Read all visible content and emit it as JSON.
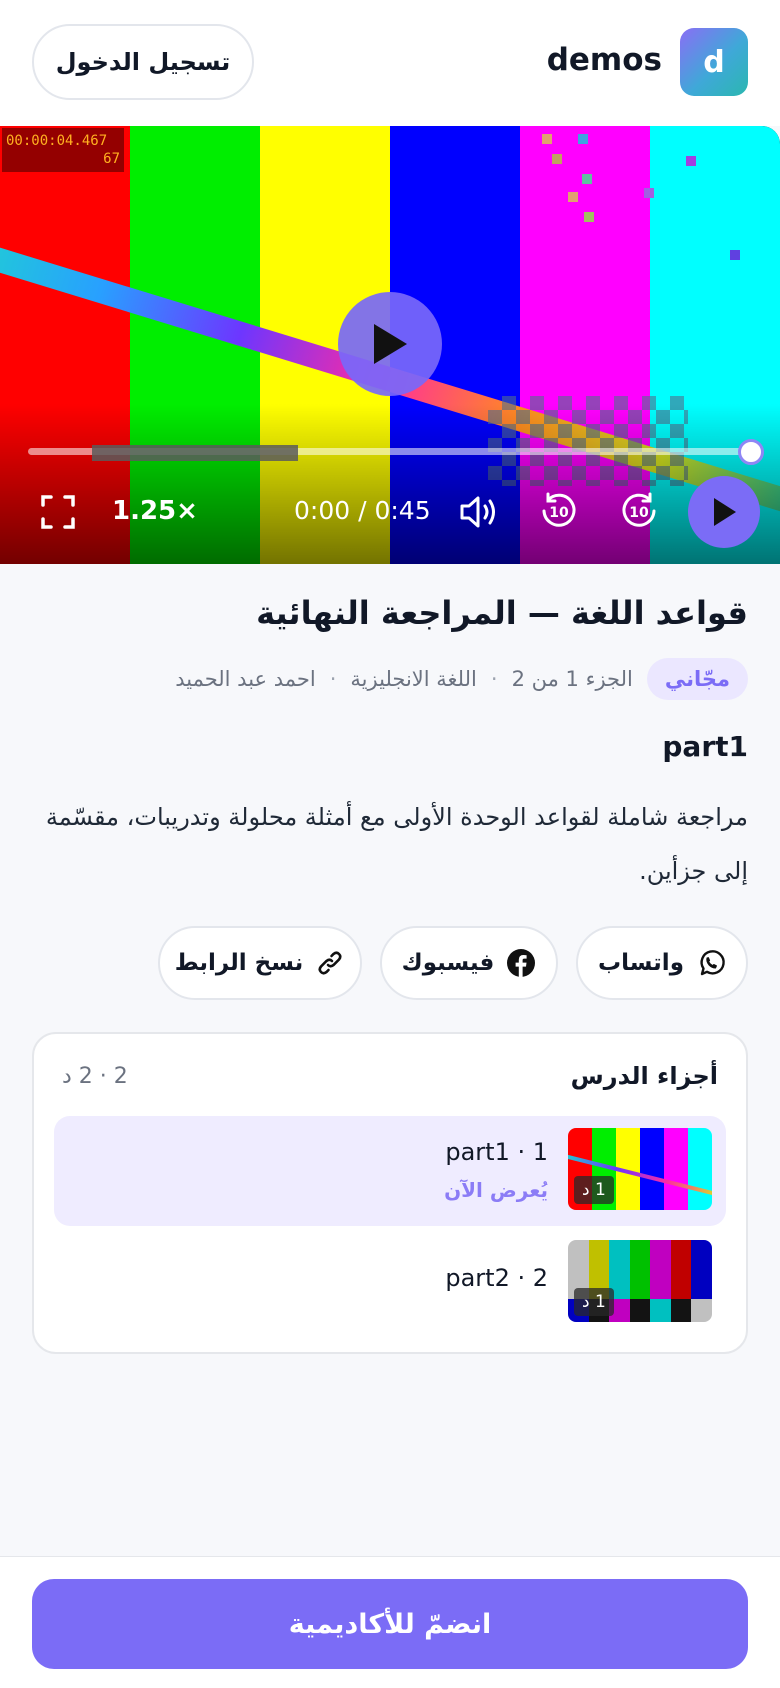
{
  "header": {
    "logo_letter": "d",
    "brand": "demos",
    "login_label": "تسجيل الدخول"
  },
  "video": {
    "timecode": "00:00:04.467",
    "frame": "67",
    "speed": "1.25×",
    "time_display": "0:00 / 0:45",
    "skip_back_seconds": "10",
    "skip_forward_seconds": "10",
    "played_fraction": 0.0,
    "bar_colors": [
      "#ff0000",
      "#00ee00",
      "#ffff00",
      "#0000ff",
      "#ff00ff",
      "#00ffff"
    ]
  },
  "lesson": {
    "title": "قواعد اللغة — المراجعة النهائية",
    "badge": "مجّاني",
    "part_info": "الجزء 1 من 2",
    "subject": "اللغة الانجليزية",
    "teacher": "احمد عبد الحميد",
    "part_heading": "part1",
    "description": "مراجعة شاملة لقواعد الوحدة الأولى مع أمثلة محلولة وتدريبات، مقسّمة إلى جزأين."
  },
  "share": {
    "whatsapp": "واتساب",
    "facebook": "فيسبوك",
    "copy_link": "نسخ الرابط"
  },
  "parts": {
    "title": "أجزاء الدرس",
    "count": "2 · 2 د",
    "items": [
      {
        "name": "part1 · 1",
        "status": "يُعرض الآن",
        "duration": "1 د",
        "active": true
      },
      {
        "name": "part2 · 2",
        "status": "",
        "duration": "1 د",
        "active": false
      }
    ]
  },
  "footer": {
    "join_label": "انضمّ للأكاديمية"
  },
  "colors": {
    "accent": "#7b6cf6"
  }
}
